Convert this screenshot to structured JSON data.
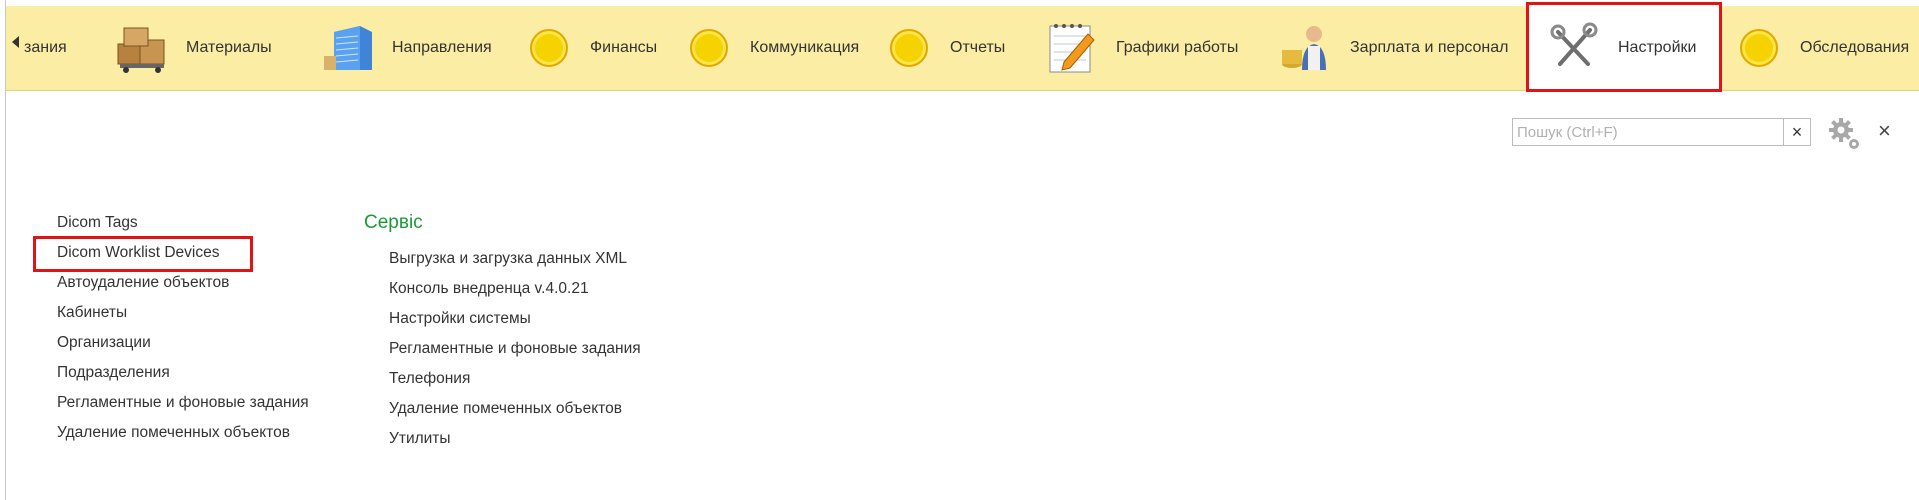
{
  "sections": {
    "cut_item": "зания",
    "items": [
      {
        "label": "Материалы",
        "icon": "boxes-icon"
      },
      {
        "label": "Направления",
        "icon": "building-icon"
      },
      {
        "label": "Финансы",
        "icon": "coin-icon"
      },
      {
        "label": "Коммуникация",
        "icon": "coin-icon"
      },
      {
        "label": "Отчеты",
        "icon": "coin-icon"
      },
      {
        "label": "Графики работы",
        "icon": "notepad-icon"
      },
      {
        "label": "Зарплата и персонал",
        "icon": "worker-icon"
      },
      {
        "label": "Настройки",
        "icon": "tools-icon",
        "active": true
      },
      {
        "label": "Обследования",
        "icon": "coin-icon"
      }
    ]
  },
  "search": {
    "placeholder": "Пошук (Ctrl+F)",
    "value": "",
    "clear": "×"
  },
  "close_glyph": "×",
  "left_list": [
    "Dicom Tags",
    "Dicom Worklist Devices",
    "Автоудаление объектов",
    "Кабинеты",
    "Организации",
    "Подразделения",
    "Регламентные и фоновые задания",
    "Удаление помеченных объектов"
  ],
  "service": {
    "title": "Сервіс",
    "items": [
      "Выгрузка и загрузка данных XML",
      "Консоль внедренца v.4.0.21",
      "Настройки системы",
      "Регламентные и фоновые задания",
      "Телефония",
      "Удаление помеченных объектов",
      "Утилиты"
    ]
  },
  "colors": {
    "bar": "#fbeda3",
    "highlight": "#e01414",
    "service_title": "#1a9a36"
  }
}
